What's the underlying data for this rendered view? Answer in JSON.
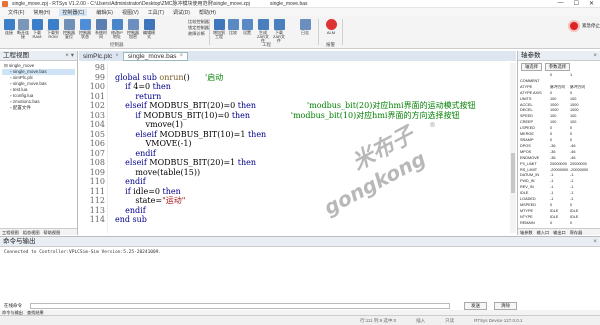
{
  "window": {
    "title": "single_move.zpj - RTSys V1.2.00 - C:\\Users\\Administrator\\Desktop\\ZMC脉冲模块使用范例\\single_move.zpj",
    "center_title": "single_move.bas"
  },
  "menu": [
    "文件(F)",
    "常用(H)",
    "控制器(C)",
    "编辑(E)",
    "视图(V)",
    "工具(T)",
    "调试(D)",
    "帮助(H)"
  ],
  "active_menu": "控制器(C)",
  "ribbon": {
    "buttons": [
      {
        "label": "连接",
        "icon": "connect-icon",
        "color": "#3c7fc9"
      },
      {
        "label": "断开连接",
        "icon": "disconnect-icon",
        "color": "#7a96b8"
      },
      {
        "label": "下载RAM",
        "icon": "download-ram-icon",
        "color": "#3c7fc9"
      },
      {
        "label": "下载到ROM",
        "icon": "download-rom-icon",
        "color": "#3c7fc9"
      },
      {
        "label": "控制器复位",
        "icon": "reset-icon",
        "color": "#6f8fb8"
      },
      {
        "label": "控制器状态",
        "icon": "status-icon",
        "color": "#4f8ed6"
      },
      {
        "label": "系统时间",
        "icon": "clock-icon",
        "color": "#5b7fb0"
      },
      {
        "label": "修改IP地址",
        "icon": "ip-icon",
        "color": "#4a86c8"
      },
      {
        "label": "控制器加密",
        "icon": "lock-icon",
        "color": "#6c8fbf"
      },
      {
        "label": "编辑模式",
        "icon": "edit-mode-icon",
        "color": "#3f76bb"
      },
      {
        "label": "增加到工程",
        "icon": "add-project-icon",
        "color": "#3f76bb"
      },
      {
        "label": "比较",
        "icon": "compare-icon",
        "color": "#5a8ac4"
      },
      {
        "label": "设置",
        "icon": "settings-icon",
        "color": "#5a8ac4"
      },
      {
        "label": "生成ZAR文件",
        "icon": "zar-icon",
        "color": "#4a7fbf"
      },
      {
        "label": "下载ZAR文件",
        "icon": "zar-download-icon",
        "color": "#4a7fbf"
      },
      {
        "label": "日志",
        "icon": "log-icon",
        "color": "#6a8fbf"
      },
      {
        "label": "ALM",
        "icon": "alarm-icon",
        "color": "#d33"
      }
    ],
    "mini_items": [
      "比较控制器",
      "锁定控制器",
      "故障诊断"
    ],
    "groups": [
      "控制器",
      "工程",
      "报警"
    ],
    "emergency": "紧急停止"
  },
  "project": {
    "title": "工程视图",
    "tree": [
      "single_move",
      "single_move.bas",
      "simPlc.plc",
      "single_move.bas",
      "test.lua",
      "Iconfig.lua",
      "zmotion1.bas",
      "配置文件"
    ],
    "selected": 1,
    "tabs": [
      "工程视图",
      "组态视图",
      "帮助视图"
    ]
  },
  "editor": {
    "tabs": [
      {
        "label": "simPlc.plc",
        "close": "×"
      },
      {
        "label": "single_move.bas",
        "close": "×"
      }
    ],
    "line_numbers": [
      "98",
      "99",
      "100",
      "101",
      "102",
      "103",
      "104",
      "105",
      "106",
      "107",
      "108",
      "109",
      "110",
      "111",
      "112",
      "113",
      "114"
    ],
    "lines": [
      {
        "parts": [
          {
            "t": "",
            "c": "nm"
          }
        ]
      },
      {
        "parts": [
          {
            "t": "global sub ",
            "c": "kw"
          },
          {
            "t": "onrun",
            "c": "fn"
          },
          {
            "t": "()      ",
            "c": "nm"
          },
          {
            "t": "'启动",
            "c": "cm"
          }
        ]
      },
      {
        "parts": [
          {
            "t": "    if ",
            "c": "kw"
          },
          {
            "t": "4=0 ",
            "c": "nm"
          },
          {
            "t": "then",
            "c": "kw"
          }
        ]
      },
      {
        "parts": [
          {
            "t": "        return",
            "c": "kw"
          }
        ]
      },
      {
        "parts": [
          {
            "t": "    elseif ",
            "c": "kw"
          },
          {
            "t": "MODBUS_BIT(20)=0 ",
            "c": "nm"
          },
          {
            "t": "then",
            "c": "kw"
          },
          {
            "t": "                    'modbus_bit(20)对应hmi界面的运动模式按钮",
            "c": "cm"
          }
        ]
      },
      {
        "parts": [
          {
            "t": "        if ",
            "c": "kw"
          },
          {
            "t": "MODBUS_BIT(10)=0 ",
            "c": "nm"
          },
          {
            "t": "then",
            "c": "kw"
          },
          {
            "t": "                'modbus_bit(10)对应hmi界面的方向选择按钮",
            "c": "cm"
          }
        ]
      },
      {
        "parts": [
          {
            "t": "            vmove(1)",
            "c": "nm"
          }
        ]
      },
      {
        "parts": [
          {
            "t": "        elseif ",
            "c": "kw"
          },
          {
            "t": "MODBUS_BIT(10)=1 ",
            "c": "nm"
          },
          {
            "t": "then",
            "c": "kw"
          }
        ]
      },
      {
        "parts": [
          {
            "t": "            VMOVE(-1)",
            "c": "nm"
          }
        ]
      },
      {
        "parts": [
          {
            "t": "        endif",
            "c": "kw"
          }
        ]
      },
      {
        "parts": [
          {
            "t": "    elseif ",
            "c": "kw"
          },
          {
            "t": "MODBUS_BIT(20)=1 ",
            "c": "nm"
          },
          {
            "t": "then",
            "c": "kw"
          }
        ]
      },
      {
        "parts": [
          {
            "t": "        move(table(15))",
            "c": "nm"
          }
        ]
      },
      {
        "parts": [
          {
            "t": "    endif",
            "c": "kw"
          }
        ]
      },
      {
        "parts": [
          {
            "t": "    if ",
            "c": "kw"
          },
          {
            "t": "idle=0 ",
            "c": "nm"
          },
          {
            "t": "then",
            "c": "kw"
          }
        ]
      },
      {
        "parts": [
          {
            "t": "        state=",
            "c": "nm"
          },
          {
            "t": "\"运动\"",
            "c": "st"
          }
        ]
      },
      {
        "parts": [
          {
            "t": "    endif",
            "c": "kw"
          }
        ]
      },
      {
        "parts": [
          {
            "t": "end sub",
            "c": "kw"
          }
        ]
      }
    ]
  },
  "watermark": {
    "cn": "米布子",
    "en": "gongkong",
    "reg": "®"
  },
  "axis_params": {
    "title": "轴参数",
    "buttons": [
      "轴选择",
      "参数选择"
    ],
    "header": [
      "",
      "0",
      "1"
    ],
    "rows": [
      [
        "COMMENT",
        "",
        ""
      ],
      [
        "ATYPE",
        "脉冲方向",
        "脉冲方向"
      ],
      [
        "ATYPE AXIS",
        "0",
        "0"
      ],
      [
        "UNITS",
        "100",
        "100"
      ],
      [
        "ACCEL",
        "1000",
        "1000"
      ],
      [
        "DECEL",
        "1000",
        "1000"
      ],
      [
        "SPEED",
        "100",
        "100"
      ],
      [
        "CREEP",
        "100",
        "100"
      ],
      [
        "LSPEED",
        "0",
        "0"
      ],
      [
        "MERGE",
        "0",
        "0"
      ],
      [
        "SRAMP",
        "0",
        "0"
      ],
      [
        "DPOS",
        "-36",
        "-46"
      ],
      [
        "MPOS",
        "-36",
        "-46"
      ],
      [
        "ENDMOVE",
        "-36",
        "-46"
      ],
      [
        "FS_LIMIT",
        "20000000",
        "20000000"
      ],
      [
        "RS_LIMIT",
        "-20000000",
        "-20000000"
      ],
      [
        "DATUM_IN",
        "-1",
        "-1"
      ],
      [
        "FWD_IN",
        "-1",
        "-1"
      ],
      [
        "REV_IN",
        "-1",
        "-1"
      ],
      [
        "IDLE",
        "-1",
        "-1"
      ],
      [
        "LOADED",
        "-1",
        "-1"
      ],
      [
        "MSPEED",
        "0",
        "0"
      ],
      [
        "MTYPE",
        "IDLE",
        "IDLE"
      ],
      [
        "NTYPE",
        "IDLE",
        "IDLE"
      ],
      [
        "REMAIN",
        "0",
        "0"
      ]
    ],
    "tabs": [
      "轴参数",
      "输入口",
      "输出口",
      "寄存器"
    ]
  },
  "command": {
    "title": "命令与输出",
    "output": "Connected to Controller:VPLCSim-Sim Version:5.25-20241009.",
    "label": "在线命令",
    "buttons": [
      "发送",
      "清除"
    ],
    "tabs": [
      "命令与输出",
      "查找结果"
    ]
  },
  "status": [
    "行:111 列:9  选中:0",
    "插入",
    "只读",
    "RTSys Device 127.0.0.1"
  ]
}
